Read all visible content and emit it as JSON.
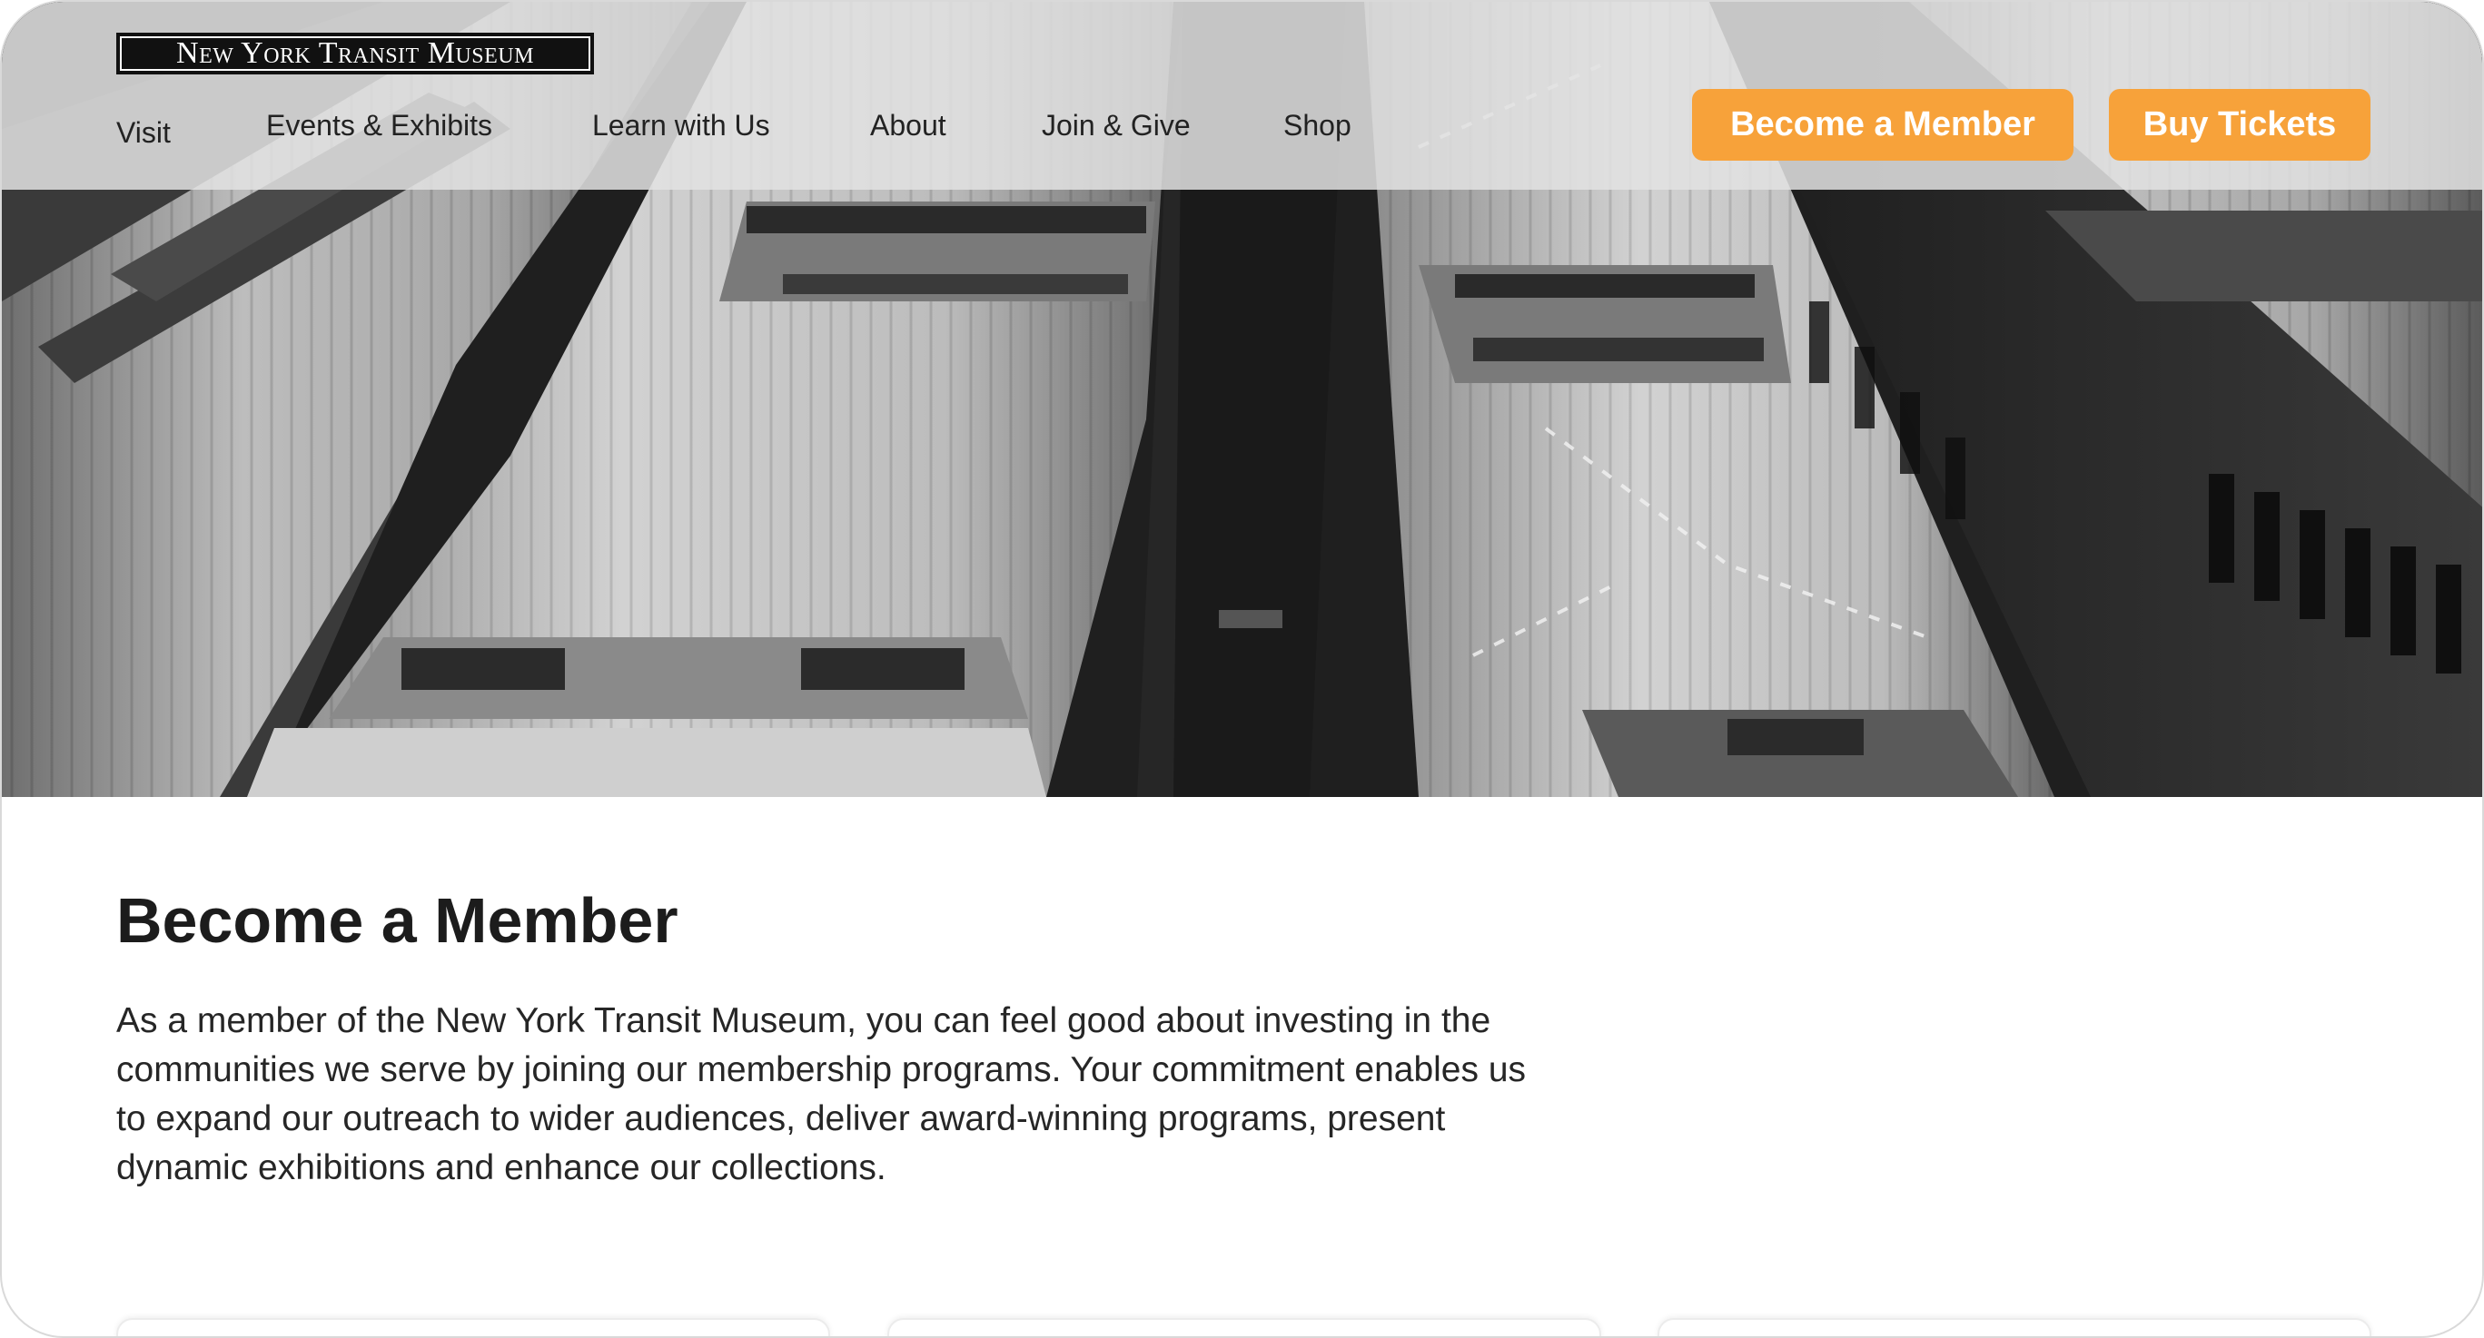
{
  "logo": {
    "text": "New York Transit Museum"
  },
  "nav": {
    "items": [
      {
        "label": "Visit"
      },
      {
        "label": "Events & Exhibits"
      },
      {
        "label": "Learn with Us"
      },
      {
        "label": "About"
      },
      {
        "label": "Join & Give"
      },
      {
        "label": "Shop"
      }
    ]
  },
  "header_buttons": {
    "member": "Become a Member",
    "tickets": "Buy Tickets"
  },
  "hero": {
    "image": "overhead view of parked subway cars (black & white photograph)"
  },
  "main": {
    "title": "Become a Member",
    "body": "As a member of the New York Transit Museum, you can feel good about investing in the communities we serve by joining our membership programs. Your commitment enables us to expand our outreach to wider audiences, deliver award-winning programs, present dynamic exhibitions and enhance our collections."
  },
  "colors": {
    "accent": "#f7a23a",
    "header_band": "#e2e2e2",
    "text": "#1f1f1f"
  }
}
